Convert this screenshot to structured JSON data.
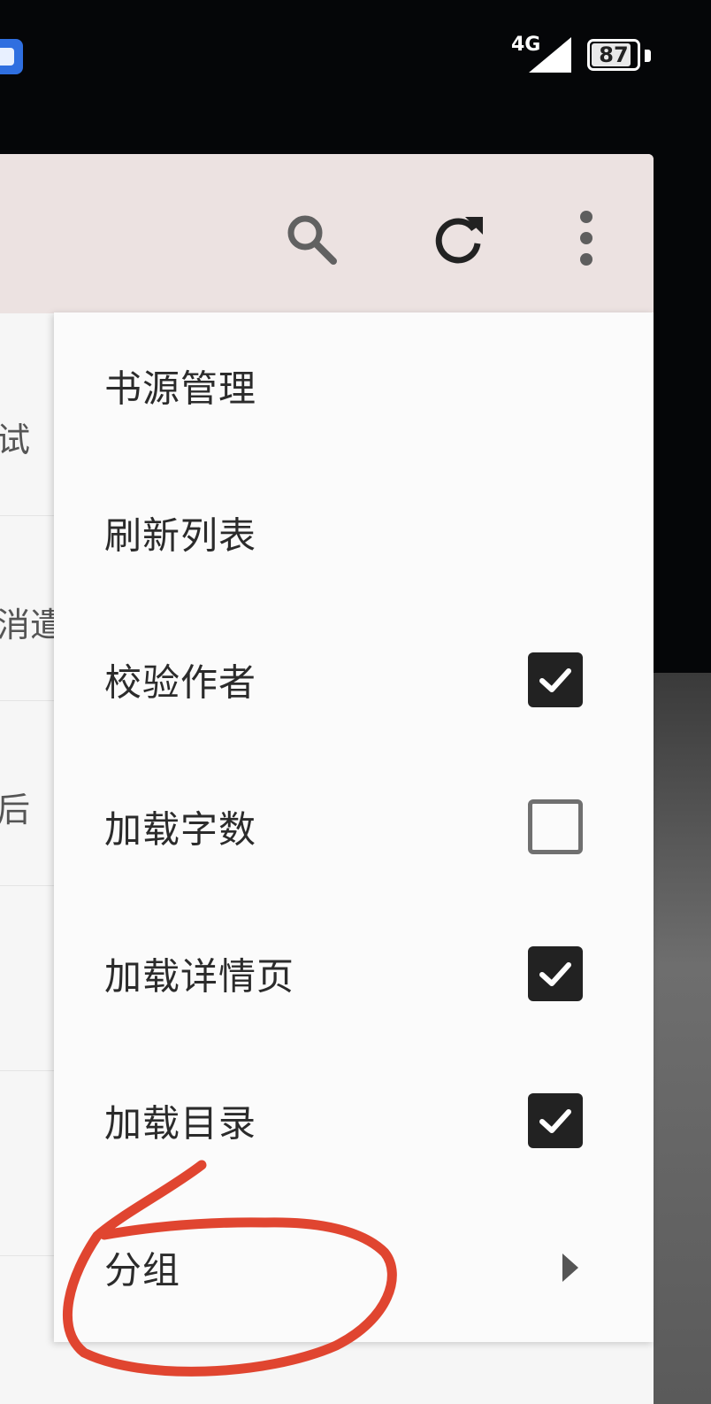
{
  "status_bar": {
    "network": "4G",
    "battery": 87
  },
  "toolbar": {
    "icons": [
      "search-icon",
      "refresh-icon",
      "more-vert-icon"
    ]
  },
  "background_list": {
    "fragments": [
      "试",
      "消遣",
      "后"
    ]
  },
  "menu": {
    "items": [
      {
        "label": "书源管理",
        "type": "action"
      },
      {
        "label": "刷新列表",
        "type": "action"
      },
      {
        "label": "校验作者",
        "type": "checkbox",
        "checked": true
      },
      {
        "label": "加载字数",
        "type": "checkbox",
        "checked": false
      },
      {
        "label": "加载详情页",
        "type": "checkbox",
        "checked": true
      },
      {
        "label": "加载目录",
        "type": "checkbox",
        "checked": true
      },
      {
        "label": "分组",
        "type": "submenu"
      }
    ]
  },
  "colors": {
    "toolbar_bg": "#ece2e1",
    "menu_bg": "#fbfbfb",
    "annotation": "#e04530"
  }
}
